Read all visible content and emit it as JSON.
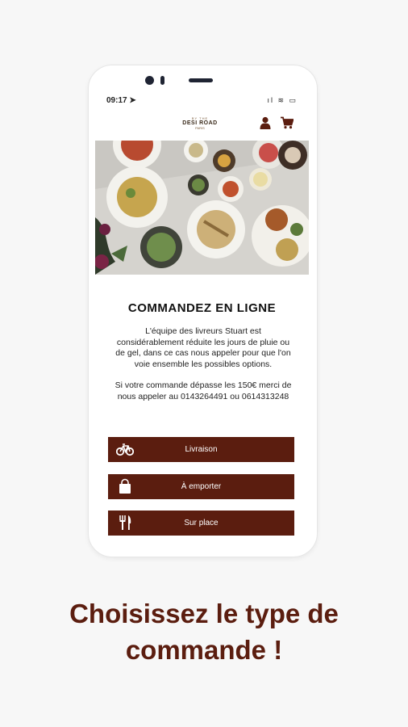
{
  "status_bar": {
    "time": "09:17 ➤",
    "icons": "ıl ≋ ▭"
  },
  "header": {
    "logo": {
      "top": "BY THE",
      "name": "DESI ROAD",
      "sub": "PARIS"
    },
    "user_icon": "user-icon",
    "cart_icon": "cart-icon"
  },
  "content": {
    "title": "COMMANDEZ EN LIGNE",
    "paragraph1": "L'équipe des livreurs Stuart est considérablement réduite les jours de pluie ou de gel, dans ce cas nous appeler pour que l'on voie ensemble les possibles options.",
    "paragraph2": "Si votre commande dépasse les 150€ merci de nous appeler au 0143264491 ou 0614313248"
  },
  "buttons": [
    {
      "label": "Livraison",
      "icon": "bicycle-icon"
    },
    {
      "label": "À emporter",
      "icon": "shopping-bag-icon"
    },
    {
      "label": "Sur place",
      "icon": "fork-knife-icon"
    }
  ],
  "caption": {
    "line1": "Choisissez le type de",
    "line2": "commande !"
  },
  "colors": {
    "accent": "#5b1d0f",
    "background": "#f7f7f7"
  }
}
